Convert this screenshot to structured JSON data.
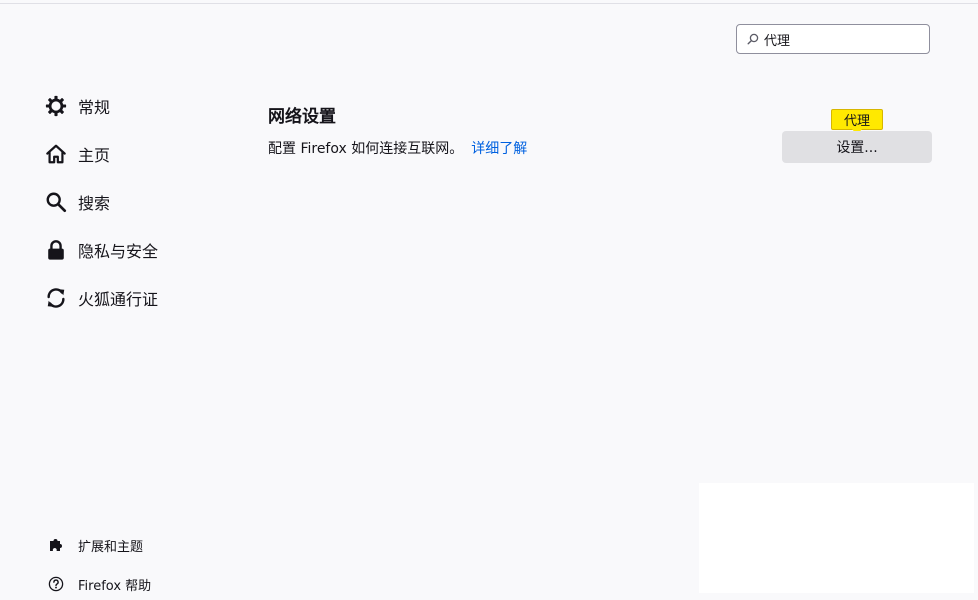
{
  "search": {
    "value": "代理",
    "icon": "search-icon"
  },
  "nav": {
    "items": [
      {
        "label": "常规",
        "icon": "gear-icon"
      },
      {
        "label": "主页",
        "icon": "home-icon"
      },
      {
        "label": "搜索",
        "icon": "search-icon"
      },
      {
        "label": "隐私与安全",
        "icon": "lock-icon"
      },
      {
        "label": "火狐通行证",
        "icon": "sync-icon"
      }
    ]
  },
  "bottom": {
    "extensions_label": "扩展和主题",
    "help_label": "Firefox 帮助"
  },
  "network": {
    "title": "网络设置",
    "description": "配置 Firefox 如何连接互联网。",
    "learn_more": "详细了解",
    "settings_button": "设置...",
    "tooltip": "代理"
  },
  "colors": {
    "background": "#f9f9fb",
    "link": "#0061e0",
    "tooltip_bg": "#ffe900",
    "button_bg": "#e0e0e3"
  }
}
